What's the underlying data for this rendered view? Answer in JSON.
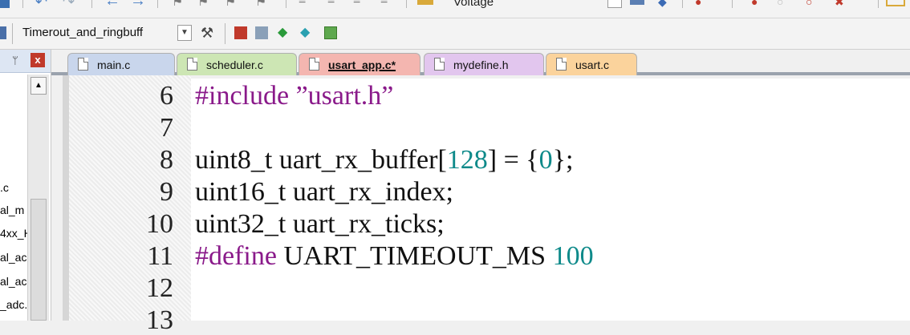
{
  "toolbar": {
    "voltage_label": "Voltage",
    "target": "Timerout_and_ringbuff"
  },
  "left_panel": {
    "files": [
      ".c",
      "al_m",
      "4xx_H",
      "al_ac",
      "al_ac",
      "_adc."
    ]
  },
  "tabs": [
    {
      "label": "main.c",
      "color": "#c9d6ec",
      "active": false
    },
    {
      "label": "scheduler.c",
      "color": "#cde6b4",
      "active": false
    },
    {
      "label": "usart_app.c*",
      "color": "#f4b6b0",
      "active": true
    },
    {
      "label": "mydefine.h",
      "color": "#e2c6ee",
      "active": false
    },
    {
      "label": "usart.c",
      "color": "#fbd39c",
      "active": false
    }
  ],
  "editor": {
    "lines": [
      {
        "num": "6",
        "code": [
          {
            "t": "#include ",
            "c": "kw"
          },
          {
            "t": "”usart.h”",
            "c": "str"
          }
        ]
      },
      {
        "num": "7",
        "code": []
      },
      {
        "num": "8",
        "code": [
          {
            "t": "uint8_t uart_rx_buffer[",
            "c": ""
          },
          {
            "t": "128",
            "c": "num"
          },
          {
            "t": "] = {",
            "c": ""
          },
          {
            "t": "0",
            "c": "num"
          },
          {
            "t": "};",
            "c": ""
          }
        ]
      },
      {
        "num": "9",
        "code": [
          {
            "t": "uint16_t uart_rx_index;",
            "c": ""
          }
        ]
      },
      {
        "num": "10",
        "code": [
          {
            "t": "uint32_t uart_rx_ticks;",
            "c": ""
          }
        ]
      },
      {
        "num": "11",
        "code": [
          {
            "t": "#define",
            "c": "kw"
          },
          {
            "t": " UART_TIMEOUT_MS ",
            "c": ""
          },
          {
            "t": "100",
            "c": "num"
          }
        ]
      },
      {
        "num": "12",
        "code": []
      },
      {
        "num": "13",
        "code": []
      }
    ]
  }
}
